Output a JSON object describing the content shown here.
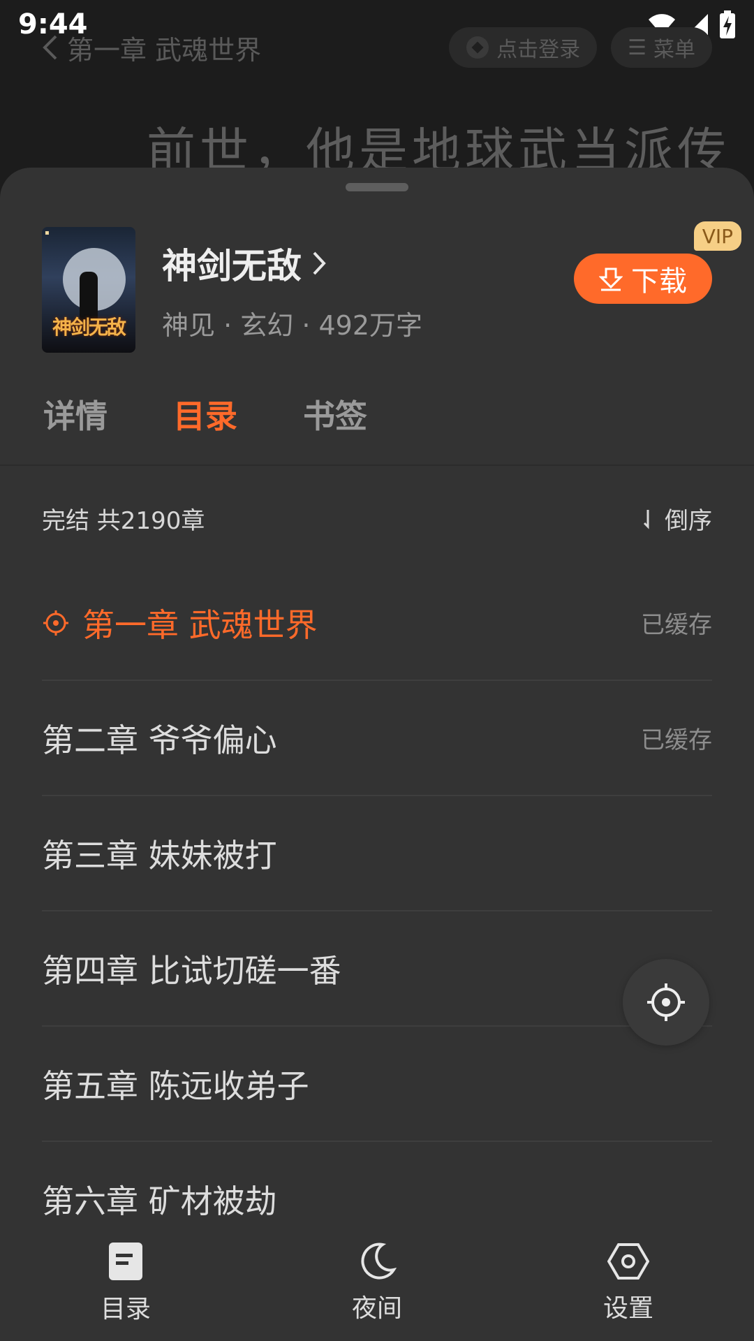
{
  "status_bar": {
    "time": "9:44"
  },
  "reader": {
    "chapter_title": "第一章 武魂世界",
    "login_label": "点击登录",
    "menu_label": "菜单",
    "text_line": "前世，他是地球武当派传"
  },
  "book": {
    "cover_title": "神剑无敌",
    "title": "神剑无敌",
    "meta": "神见 · 玄幻 · 492万字",
    "download_label": "下载",
    "vip_label": "VIP"
  },
  "tabs": [
    {
      "label": "详情"
    },
    {
      "label": "目录"
    },
    {
      "label": "书签"
    }
  ],
  "summary": {
    "status": "完结 共2190章",
    "sort_label": "倒序"
  },
  "chapters": [
    {
      "title": "第一章 武魂世界",
      "cache": "已缓存"
    },
    {
      "title": "第二章 爷爷偏心",
      "cache": "已缓存"
    },
    {
      "title": "第三章 妹妹被打",
      "cache": ""
    },
    {
      "title": "第四章 比试切磋一番",
      "cache": ""
    },
    {
      "title": "第五章 陈远收弟子",
      "cache": ""
    },
    {
      "title": "第六章 矿材被劫",
      "cache": ""
    }
  ],
  "bottom_nav": [
    {
      "label": "目录",
      "icon": "catalog-icon"
    },
    {
      "label": "夜间",
      "icon": "moon-icon"
    },
    {
      "label": "设置",
      "icon": "settings-icon"
    }
  ],
  "colors": {
    "accent": "#ff6a2a",
    "sheet_bg": "#333333",
    "vip_bg": "#f6cf86"
  }
}
